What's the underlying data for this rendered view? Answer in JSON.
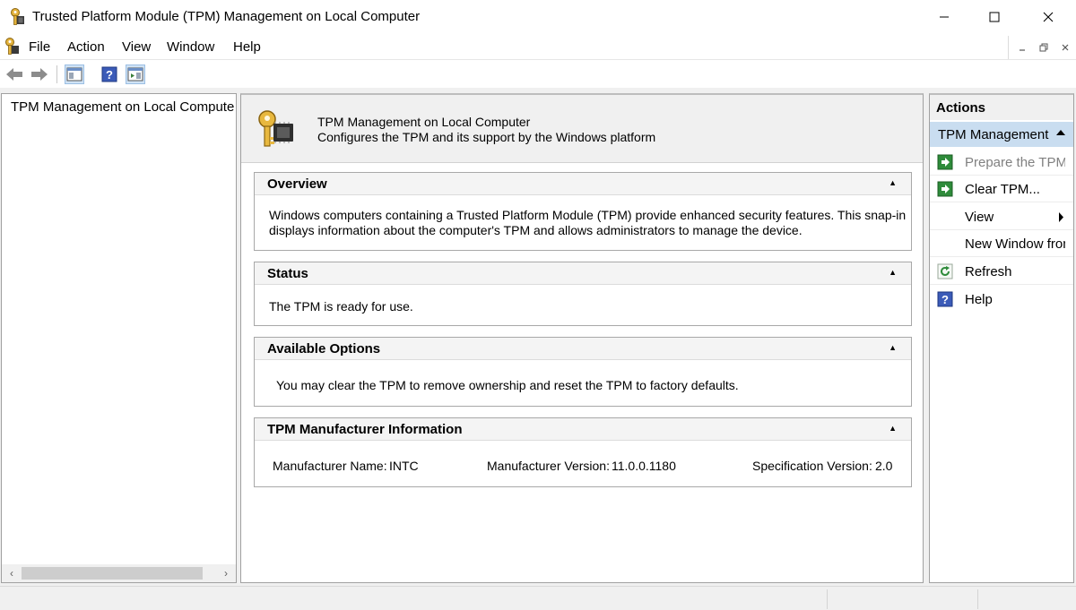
{
  "window": {
    "title": "Trusted Platform Module (TPM) Management on Local Computer"
  },
  "menu": {
    "items": [
      "File",
      "Action",
      "View",
      "Window",
      "Help"
    ]
  },
  "tree": {
    "root_label": "TPM Management on Local Computer"
  },
  "header": {
    "title": "TPM Management on Local Computer",
    "subtitle": "Configures the TPM and its support by the Windows platform"
  },
  "sections": {
    "overview": {
      "title": "Overview",
      "line1": "Windows computers containing a Trusted Platform Module (TPM) provide enhanced security features. This snap-in",
      "line2": "displays information about the computer's TPM and allows administrators to manage the device."
    },
    "status": {
      "title": "Status",
      "text": "The TPM is ready for use."
    },
    "options": {
      "title": "Available Options",
      "text": "You may clear the TPM to remove ownership and reset the TPM to factory defaults."
    },
    "manufacturer": {
      "title": "TPM Manufacturer Information",
      "name_label": "Manufacturer Name:",
      "name_value": "INTC",
      "version_label": "Manufacturer Version:",
      "version_value": "11.0.0.1180",
      "spec_label": "Specification Version:",
      "spec_value": "2.0"
    }
  },
  "actions": {
    "title": "Actions",
    "group_label": "TPM Management on Local Computer",
    "items": [
      {
        "label": "Prepare the TPM...",
        "icon": "green-arrow-icon",
        "enabled": false
      },
      {
        "label": "Clear TPM...",
        "icon": "green-arrow-icon",
        "enabled": true
      },
      {
        "label": "View",
        "icon": "",
        "enabled": true
      },
      {
        "label": "New Window from Here",
        "icon": "",
        "enabled": true
      },
      {
        "label": "Refresh",
        "icon": "refresh-icon",
        "enabled": true
      },
      {
        "label": "Help",
        "icon": "help-icon",
        "enabled": true
      }
    ]
  },
  "colors": {
    "selected_group": "#c9ddf0",
    "pane_bg": "#f0f0f0",
    "action_green": "#2e8b3a",
    "help_blue": "#3b5bb8"
  }
}
